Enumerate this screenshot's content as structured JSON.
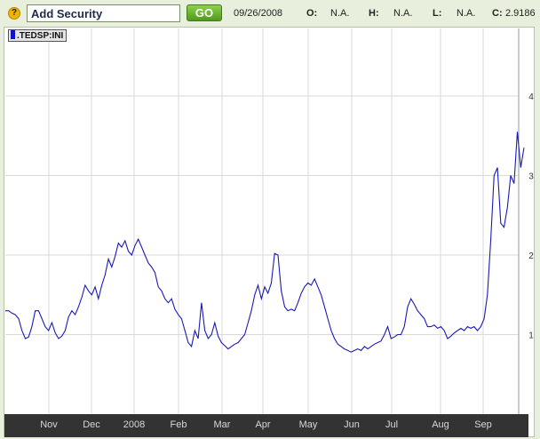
{
  "toolbar": {
    "help_glyph": "?",
    "symbol_input_value": "Add Security",
    "go_label": "GO",
    "date": "09/26/2008",
    "open_label": "O:",
    "open_value": "N.A.",
    "high_label": "H:",
    "high_value": "N.A.",
    "low_label": "L:",
    "low_value": "N.A.",
    "close_label": "C:",
    "close_value": "2.9186"
  },
  "legend": {
    "label": ".TEDSP:INI",
    "color": "#1010c8"
  },
  "colors": {
    "line": "#1a1ab8",
    "grid": "#d9d9d9",
    "axis_bar": "#333333",
    "axis_text": "#d8d8d8",
    "frame_bg": "#e8efdc",
    "accent_go": "#5aa626"
  },
  "chart_data": {
    "type": "line",
    "series": [
      {
        "name": ".TEDSP:INI",
        "values": [
          1.3,
          1.3,
          1.27,
          1.25,
          1.2,
          1.05,
          0.95,
          0.97,
          1.1,
          1.3,
          1.3,
          1.2,
          1.1,
          1.05,
          1.15,
          1.02,
          0.95,
          0.98,
          1.05,
          1.22,
          1.3,
          1.25,
          1.35,
          1.47,
          1.62,
          1.55,
          1.5,
          1.6,
          1.45,
          1.62,
          1.75,
          1.95,
          1.85,
          1.98,
          2.15,
          2.1,
          2.18,
          2.05,
          2.0,
          2.12,
          2.2,
          2.1,
          2.0,
          1.9,
          1.85,
          1.78,
          1.6,
          1.55,
          1.45,
          1.4,
          1.45,
          1.32,
          1.25,
          1.2,
          1.05,
          0.9,
          0.85,
          1.05,
          0.95,
          1.4,
          1.05,
          0.95,
          1.0,
          1.15,
          0.98,
          0.9,
          0.86,
          0.82,
          0.85,
          0.88,
          0.9,
          0.95,
          1.0,
          1.15,
          1.3,
          1.5,
          1.62,
          1.45,
          1.6,
          1.52,
          1.65,
          2.02,
          2.0,
          1.55,
          1.35,
          1.3,
          1.32,
          1.3,
          1.4,
          1.52,
          1.6,
          1.65,
          1.62,
          1.7,
          1.6,
          1.5,
          1.35,
          1.2,
          1.05,
          0.95,
          0.88,
          0.85,
          0.82,
          0.8,
          0.78,
          0.8,
          0.82,
          0.8,
          0.85,
          0.82,
          0.85,
          0.88,
          0.9,
          0.92,
          1.0,
          1.1,
          0.95,
          0.97,
          1.0,
          1.0,
          1.1,
          1.35,
          1.45,
          1.38,
          1.3,
          1.25,
          1.2,
          1.1,
          1.1,
          1.12,
          1.08,
          1.1,
          1.05,
          0.95,
          0.98,
          1.02,
          1.05,
          1.08,
          1.05,
          1.1,
          1.08,
          1.1,
          1.05,
          1.1,
          1.2,
          1.5,
          2.2,
          3.0,
          3.1,
          2.4,
          2.35,
          2.6,
          3.0,
          2.9,
          3.55,
          3.1,
          3.35
        ]
      }
    ],
    "x_labels": [
      "Nov",
      "Dec",
      "2008",
      "Feb",
      "Mar",
      "Apr",
      "May",
      "Jun",
      "Jul",
      "Aug",
      "Sep"
    ],
    "y_ticks": [
      1,
      2,
      3,
      4
    ],
    "ylim": [
      0,
      4.85
    ],
    "y_axis_side": "right",
    "grid": true
  }
}
